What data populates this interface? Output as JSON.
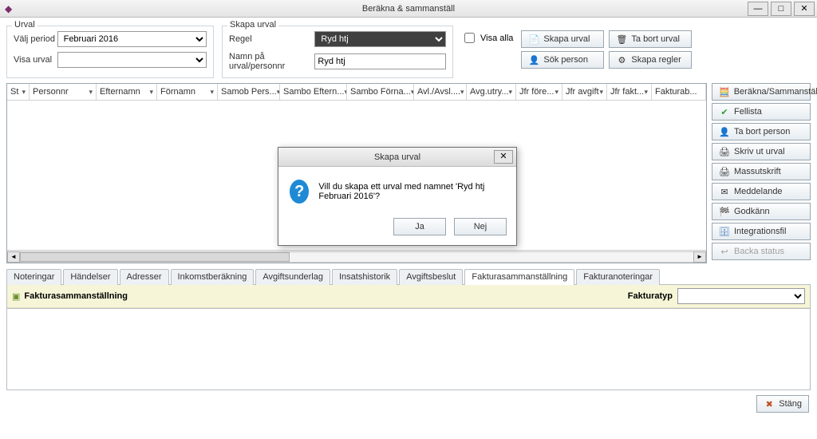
{
  "window_title": "Beräkna & sammanställ",
  "filters": {
    "urval_legend": "Urval",
    "valj_period_label": "Välj period",
    "valj_period_value": "Februari 2016",
    "visa_urval_label": "Visa urval",
    "visa_urval_value": "",
    "skapa_legend": "Skapa urval",
    "regel_label": "Regel",
    "regel_value": "Ryd htj",
    "namn_label": "Namn på urval/personnr",
    "namn_value": "Ryd htj",
    "visa_alla_label": "Visa alla"
  },
  "top_buttons": {
    "skapa_urval": "Skapa urval",
    "ta_bort_urval": "Ta bort urval",
    "sok_person": "Sök person",
    "skapa_regler": "Skapa regler"
  },
  "grid_columns": [
    "St",
    "Personnr",
    "Efternamn",
    "Förnamn",
    "Samob Pers...",
    "Sambo Eftern...",
    "Sambo Förna...",
    "Avl./Avsl....",
    "Avg.utry...",
    "Jfr före...",
    "Jfr avgift",
    "Jfr fakt...",
    "Fakturab..."
  ],
  "side_buttons": {
    "berakna": "Beräkna/Sammanställ",
    "fellista": "Fellista",
    "ta_bort_person": "Ta bort person",
    "skriv_ut": "Skriv ut urval",
    "massutskrift": "Massutskrift",
    "meddelande": "Meddelande",
    "godkann": "Godkänn",
    "integrationsfil": "Integrationsfil",
    "backa_status": "Backa status"
  },
  "tabs": [
    "Noteringar",
    "Händelser",
    "Adresser",
    "Inkomstberäkning",
    "Avgiftsunderlag",
    "Insatshistorik",
    "Avgiftsbeslut",
    "Fakturasammanställning",
    "Fakturanoteringar"
  ],
  "tab_panel": {
    "header": "Fakturasammanställning",
    "fakturatyp_label": "Fakturatyp",
    "fakturatyp_value": ""
  },
  "footer": {
    "close": "Stäng"
  },
  "modal": {
    "title": "Skapa urval",
    "message": "Vill du skapa ett urval med namnet 'Ryd htj  Februari 2016'?",
    "yes": "Ja",
    "no": "Nej"
  }
}
